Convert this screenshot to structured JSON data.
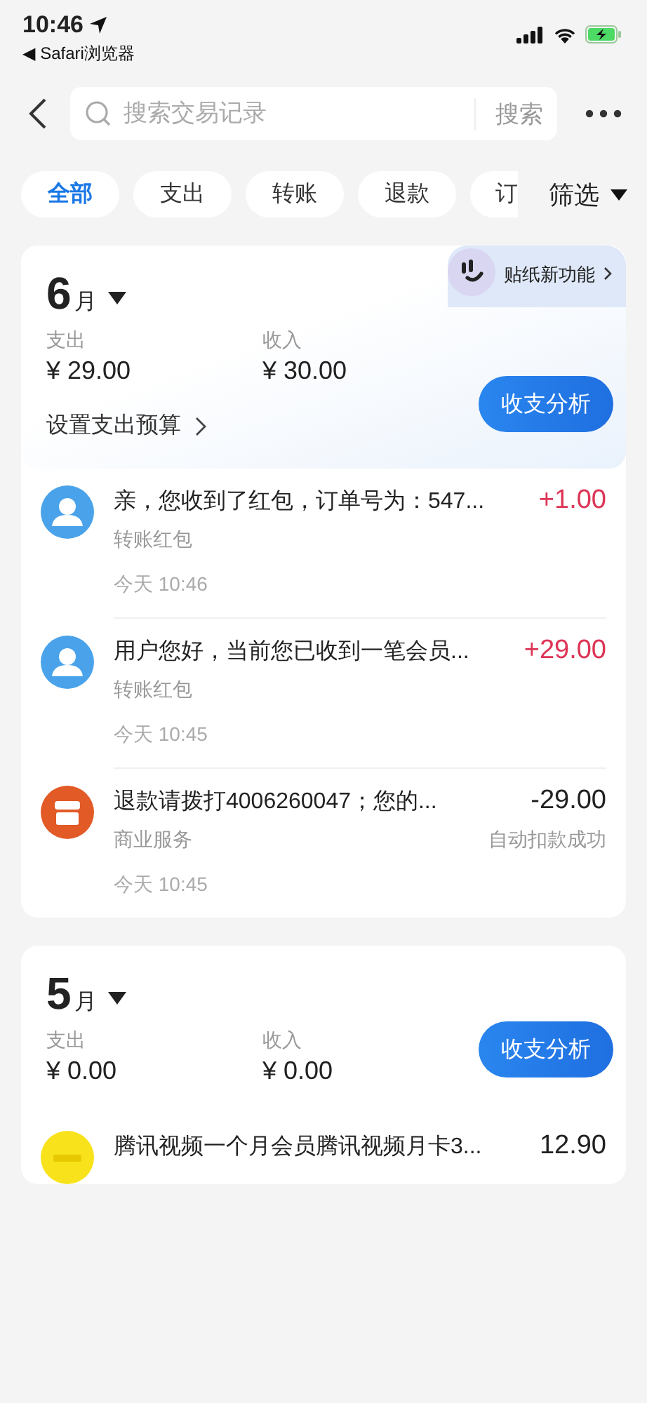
{
  "status_bar": {
    "time": "10:46",
    "back_app": "◀ Safari浏览器"
  },
  "search": {
    "placeholder": "搜索交易记录",
    "button": "搜索"
  },
  "chips": [
    {
      "label": "全部",
      "selected": true
    },
    {
      "label": "支出",
      "selected": false
    },
    {
      "label": "转账",
      "selected": false
    },
    {
      "label": "退款",
      "selected": false
    },
    {
      "label": "订",
      "selected": false
    }
  ],
  "filter": "筛选",
  "sticker_banner": "贴纸新功能",
  "months": [
    {
      "month": "6",
      "unit": "月",
      "expense_label": "支出",
      "expense": "¥ 29.00",
      "income_label": "收入",
      "income": "¥ 30.00",
      "budget_link": "设置支出预算",
      "analysis_button": "收支分析",
      "transactions": [
        {
          "kind": "person",
          "title": "亲，您收到了红包，订单号为：547...",
          "amount": "+1.00",
          "income": true,
          "category": "转账红包",
          "time": "今天 10:46"
        },
        {
          "kind": "person",
          "title": "用户您好，当前您已收到一笔会员...",
          "amount": "+29.00",
          "income": true,
          "category": "转账红包",
          "time": "今天 10:45"
        },
        {
          "kind": "shop",
          "title": "退款请拨打4006260047；您的...",
          "amount": "-29.00",
          "income": false,
          "category": "商业服务",
          "status": "自动扣款成功",
          "time": "今天 10:45"
        }
      ]
    },
    {
      "month": "5",
      "unit": "月",
      "expense_label": "支出",
      "expense": "¥ 0.00",
      "income_label": "收入",
      "income": "¥ 0.00",
      "analysis_button": "收支分析",
      "transactions": [
        {
          "kind": "video",
          "title": "腾讯视频一个月会员腾讯视频月卡3...",
          "amount": "12.90",
          "income": false
        }
      ]
    }
  ]
}
